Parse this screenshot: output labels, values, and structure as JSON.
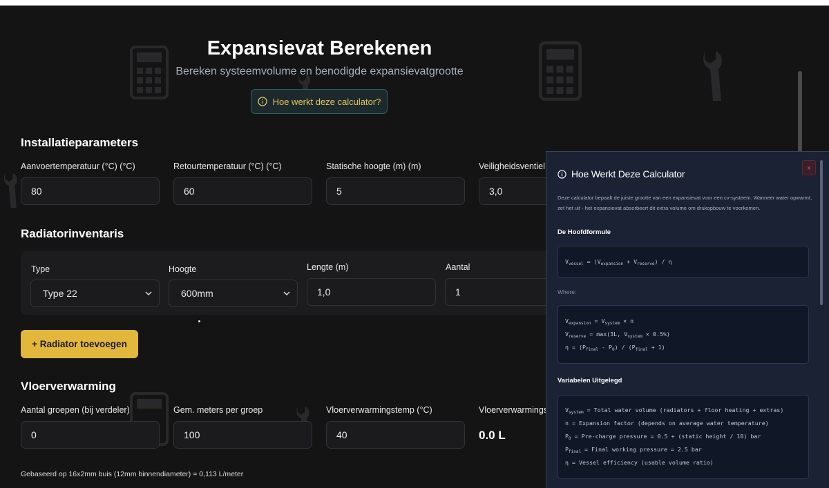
{
  "header": {
    "title": "Expansievat Berekenen",
    "subtitle": "Bereken systeemvolume en benodigde expansievatgrootte",
    "help_button": "Hoe werkt deze calculator?"
  },
  "installation": {
    "title": "Installatieparameters",
    "fields": [
      {
        "label": "Aanvoertemperatuur (°C) (°C)",
        "value": "80"
      },
      {
        "label": "Retourtemperatuur (°C) (°C)",
        "value": "60"
      },
      {
        "label": "Statische hoogte (m) (m)",
        "value": "5"
      },
      {
        "label": "Veiligheidsventiel (",
        "value": "3,0"
      }
    ]
  },
  "radiators": {
    "title": "Radiatorinventaris",
    "type_label": "Type",
    "type_value": "Type 22",
    "height_label": "Hoogte",
    "height_value": "600mm",
    "length_label": "Lengte (m)",
    "length_value": "1,0",
    "count_label": "Aantal",
    "count_value": "1",
    "add_button": "+ Radiator toevoegen"
  },
  "floor": {
    "title": "Vloerverwarming",
    "fields": [
      {
        "label": "Aantal groepen (bij verdeler)",
        "value": "0"
      },
      {
        "label": "Gem. meters per groep",
        "value": "100"
      },
      {
        "label": "Vloerverwarmingstemp (°C)",
        "value": "40"
      }
    ],
    "volume_label": "Vloerverwarmings",
    "volume_value": "0.0 L",
    "footnote": "Gebaseerd op 16x2mm buis (12mm binnendiameter) = 0,113 L/meter"
  },
  "modal": {
    "title": "Hoe Werkt Deze Calculator",
    "close": "x",
    "intro": "Deze calculator bepaalt de juiste grootte van een expansievat voor een cv-systeem. Wanneer water opwarmt, zet het uit - het expansievat absorbeert dit extra volume om drukopbouw te voorkomen.",
    "formula_heading": "De Hoofdformule",
    "where": "Where:",
    "variables_heading": "Variabelen Uitgelegd",
    "formula": {
      "v": "V",
      "vessel_sub": "vessel",
      "eq": " = (V",
      "exp_sub": "expansion",
      "plus": " + V",
      "res_sub": "reserve",
      "end": ") / η"
    },
    "defs": {
      "l1_a": "V",
      "l1_sub1": "expansion",
      "l1_b": " = V",
      "l1_sub2": "system",
      "l1_c": " × n",
      "l2_a": "V",
      "l2_sub1": "reserve",
      "l2_b": " = max(3L, V",
      "l2_sub2": "system",
      "l2_c": " × 0.5%)",
      "l3_a": "η = (P",
      "l3_sub1": "final",
      "l3_b": " - P",
      "l3_sub2": "0",
      "l3_c": ") / (P",
      "l3_sub3": "final",
      "l3_d": " + 1)"
    },
    "vars": {
      "v1_a": "V",
      "v1_sub": "system",
      "v1_b": " = Total water volume (radiators + floor heating + extras)",
      "v2": "n = Expansion factor (depends on average water temperature)",
      "v3_a": "P",
      "v3_sub": "0",
      "v3_b": " = Pre-charge pressure = 0.5 + (static height / 10) bar",
      "v4_a": "P",
      "v4_sub": "final",
      "v4_b": " = Final working pressure = 2.5 bar",
      "v5": "η = Vessel efficiency (usable volume ratio)"
    }
  },
  "icons": [
    "calculator-icon",
    "wrench-icon",
    "info-icon",
    "chevron-down-icon",
    "close-icon"
  ],
  "colors": {
    "accent": "#e2b73c",
    "background": "#141415",
    "modal": "#1b2233"
  }
}
